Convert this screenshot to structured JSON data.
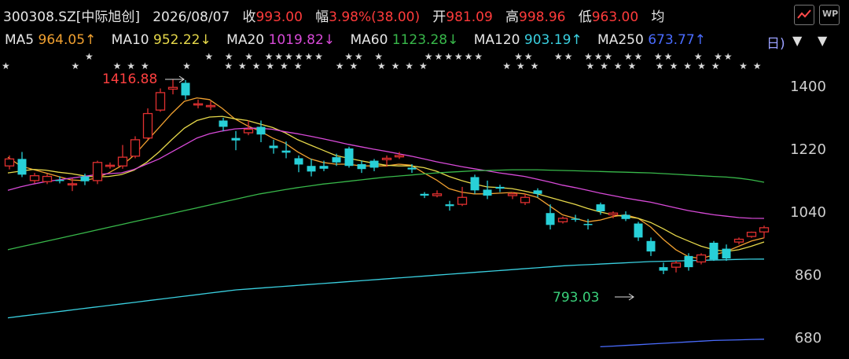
{
  "header": {
    "code": "300308.SZ[中际旭创]",
    "date": "2026/08/07",
    "close_label": "收",
    "close_value": "993.00",
    "change_label": "幅",
    "change_value": "3.98%(38.00)",
    "open_label": "开",
    "open_value": "981.09",
    "high_label": "高",
    "high_value": "998.96",
    "low_label": "低",
    "low_value": "963.00",
    "avg_label": "均",
    "right_icons": [
      "trend-icon",
      "wp-icon"
    ],
    "wp_text": "WP"
  },
  "ma_bar": {
    "items": [
      {
        "name": "MA5",
        "value": "964.05↑",
        "color": "#f0a030"
      },
      {
        "name": "MA10",
        "value": "952.22↓",
        "color": "#e6d84a"
      },
      {
        "name": "MA20",
        "value": "1019.82↓",
        "color": "#d84ad8"
      },
      {
        "name": "MA60",
        "value": "1123.28↓",
        "color": "#38b84a"
      },
      {
        "name": "MA120",
        "value": "903.19↑",
        "color": "#3ad0e0"
      },
      {
        "name": "MA250",
        "value": "673.77↑",
        "color": "#4a6cff"
      }
    ],
    "tail_text": "日)",
    "dropdown_arrow": "▼"
  },
  "chart_data": {
    "type": "candlestick",
    "y_ticks": [
      680,
      860,
      1040,
      1220,
      1400
    ],
    "ylim": [
      660,
      1480
    ],
    "high_annotation": "1416.88",
    "low_annotation": "793.03",
    "star_glyph": "★",
    "stars_row1": [
      0,
      5,
      8,
      9,
      10,
      13,
      16,
      17,
      18,
      19,
      20,
      21,
      24,
      25,
      27,
      28,
      29,
      30,
      36,
      37,
      38,
      42,
      43,
      44,
      45,
      47,
      48,
      49,
      50,
      51,
      53,
      54
    ],
    "stars_row2": [
      0,
      12,
      14,
      16,
      18,
      19,
      20,
      21,
      22,
      23,
      26,
      27,
      29,
      34,
      35,
      36,
      37,
      38,
      39,
      43,
      44,
      47,
      48,
      50,
      51,
      52,
      54,
      55,
      57,
      58,
      61,
      63,
      64
    ],
    "candles": [
      {
        "o": 1170,
        "c": 1190,
        "h": 1200,
        "l": 1160
      },
      {
        "o": 1190,
        "c": 1145,
        "h": 1210,
        "l": 1138
      },
      {
        "o": 1128,
        "c": 1142,
        "h": 1150,
        "l": 1120
      },
      {
        "o": 1125,
        "c": 1140,
        "h": 1147,
        "l": 1118
      },
      {
        "o": 1130,
        "c": 1128,
        "h": 1140,
        "l": 1120
      },
      {
        "o": 1118,
        "c": 1119,
        "h": 1135,
        "l": 1098
      },
      {
        "o": 1140,
        "c": 1126,
        "h": 1148,
        "l": 1115
      },
      {
        "o": 1128,
        "c": 1180,
        "h": 1185,
        "l": 1118
      },
      {
        "o": 1170,
        "c": 1172,
        "h": 1180,
        "l": 1162
      },
      {
        "o": 1170,
        "c": 1195,
        "h": 1230,
        "l": 1162
      },
      {
        "o": 1198,
        "c": 1245,
        "h": 1255,
        "l": 1192
      },
      {
        "o": 1250,
        "c": 1320,
        "h": 1335,
        "l": 1246
      },
      {
        "o": 1330,
        "c": 1380,
        "h": 1392,
        "l": 1325
      },
      {
        "o": 1390,
        "c": 1395,
        "h": 1416.88,
        "l": 1375
      },
      {
        "o": 1408,
        "c": 1372,
        "h": 1416,
        "l": 1360
      },
      {
        "o": 1345,
        "c": 1348,
        "h": 1360,
        "l": 1335
      },
      {
        "o": 1342,
        "c": 1343,
        "h": 1355,
        "l": 1330
      },
      {
        "o": 1300,
        "c": 1282,
        "h": 1308,
        "l": 1270
      },
      {
        "o": 1250,
        "c": 1243,
        "h": 1270,
        "l": 1215
      },
      {
        "o": 1265,
        "c": 1275,
        "h": 1300,
        "l": 1258
      },
      {
        "o": 1282,
        "c": 1260,
        "h": 1300,
        "l": 1238
      },
      {
        "o": 1228,
        "c": 1221,
        "h": 1245,
        "l": 1205
      },
      {
        "o": 1214,
        "c": 1208,
        "h": 1240,
        "l": 1192
      },
      {
        "o": 1192,
        "c": 1174,
        "h": 1200,
        "l": 1152
      },
      {
        "o": 1170,
        "c": 1154,
        "h": 1190,
        "l": 1140
      },
      {
        "o": 1170,
        "c": 1162,
        "h": 1185,
        "l": 1155
      },
      {
        "o": 1195,
        "c": 1180,
        "h": 1205,
        "l": 1170
      },
      {
        "o": 1220,
        "c": 1170,
        "h": 1225,
        "l": 1165
      },
      {
        "o": 1175,
        "c": 1161,
        "h": 1185,
        "l": 1150
      },
      {
        "o": 1185,
        "c": 1165,
        "h": 1190,
        "l": 1155
      },
      {
        "o": 1188,
        "c": 1192,
        "h": 1200,
        "l": 1168
      },
      {
        "o": 1196,
        "c": 1200,
        "h": 1210,
        "l": 1190
      },
      {
        "o": 1165,
        "c": 1160,
        "h": 1175,
        "l": 1150
      },
      {
        "o": 1090,
        "c": 1085,
        "h": 1095,
        "l": 1078
      },
      {
        "o": 1085,
        "c": 1090,
        "h": 1100,
        "l": 1080
      },
      {
        "o": 1060,
        "c": 1055,
        "h": 1070,
        "l": 1042
      },
      {
        "o": 1060,
        "c": 1080,
        "h": 1110,
        "l": 1055
      },
      {
        "o": 1138,
        "c": 1100,
        "h": 1145,
        "l": 1090
      },
      {
        "o": 1102,
        "c": 1085,
        "h": 1128,
        "l": 1075
      },
      {
        "o": 1110,
        "c": 1105,
        "h": 1116,
        "l": 1095
      },
      {
        "o": 1085,
        "c": 1090,
        "h": 1095,
        "l": 1075
      },
      {
        "o": 1065,
        "c": 1080,
        "h": 1090,
        "l": 1058
      },
      {
        "o": 1100,
        "c": 1090,
        "h": 1106,
        "l": 1080
      },
      {
        "o": 1035,
        "c": 1001,
        "h": 1060,
        "l": 988
      },
      {
        "o": 1010,
        "c": 1020,
        "h": 1025,
        "l": 1005
      },
      {
        "o": 1019,
        "c": 1018,
        "h": 1030,
        "l": 1010
      },
      {
        "o": 1004,
        "c": 1002,
        "h": 1018,
        "l": 988
      },
      {
        "o": 1060,
        "c": 1040,
        "h": 1065,
        "l": 1030
      },
      {
        "o": 1030,
        "c": 1035,
        "h": 1040,
        "l": 1020
      },
      {
        "o": 1030,
        "c": 1018,
        "h": 1040,
        "l": 1012
      },
      {
        "o": 1005,
        "c": 965,
        "h": 1010,
        "l": 955
      },
      {
        "o": 955,
        "c": 925,
        "h": 965,
        "l": 912
      },
      {
        "o": 880,
        "c": 870,
        "h": 893,
        "l": 860
      },
      {
        "o": 880,
        "c": 892,
        "h": 898,
        "l": 865
      },
      {
        "o": 912,
        "c": 880,
        "h": 920,
        "l": 870
      },
      {
        "o": 895,
        "c": 915,
        "h": 920,
        "l": 888
      },
      {
        "o": 950,
        "c": 902,
        "h": 955,
        "l": 898
      },
      {
        "o": 933,
        "c": 905,
        "h": 945,
        "l": 898
      },
      {
        "o": 952,
        "c": 960,
        "h": 965,
        "l": 945
      },
      {
        "o": 968,
        "c": 980,
        "h": 982,
        "l": 964
      },
      {
        "o": 981,
        "c": 993,
        "h": 998.96,
        "l": 963
      }
    ],
    "candle_colors": {
      "up": "#e03030",
      "down": "#28d0d8"
    },
    "ma_series": [
      {
        "name": "MA5",
        "color": "#f0a030",
        "values": [
          1195,
          1170,
          1160,
          1150,
          1140,
          1130,
          1128,
          1135,
          1150,
          1170,
          1200,
          1240,
          1280,
          1320,
          1355,
          1365,
          1360,
          1335,
          1305,
          1285,
          1270,
          1250,
          1235,
          1210,
          1190,
          1180,
          1175,
          1175,
          1170,
          1170,
          1170,
          1175,
          1172,
          1150,
          1130,
          1105,
          1095,
          1090,
          1090,
          1092,
          1094,
          1090,
          1080,
          1055,
          1030,
          1020,
          1010,
          1015,
          1025,
          1030,
          1020,
          995,
          960,
          930,
          910,
          905,
          915,
          925,
          940,
          955,
          964.05
        ]
      },
      {
        "name": "MA10",
        "color": "#e6d84a",
        "values": [
          1150,
          1155,
          1160,
          1158,
          1152,
          1148,
          1142,
          1138,
          1140,
          1145,
          1158,
          1180,
          1210,
          1245,
          1278,
          1300,
          1310,
          1312,
          1305,
          1300,
          1290,
          1280,
          1265,
          1245,
          1230,
          1215,
          1200,
          1192,
          1185,
          1178,
          1172,
          1170,
          1170,
          1165,
          1155,
          1140,
          1128,
          1118,
          1110,
          1108,
          1105,
          1098,
          1090,
          1080,
          1070,
          1060,
          1048,
          1038,
          1030,
          1025,
          1020,
          1008,
          990,
          970,
          955,
          940,
          930,
          925,
          930,
          940,
          952.22
        ]
      },
      {
        "name": "MA20",
        "color": "#d84ad8",
        "values": [
          1100,
          1110,
          1118,
          1125,
          1130,
          1135,
          1140,
          1145,
          1148,
          1150,
          1160,
          1175,
          1190,
          1210,
          1230,
          1250,
          1262,
          1270,
          1276,
          1278,
          1278,
          1275,
          1268,
          1262,
          1255,
          1248,
          1240,
          1232,
          1225,
          1218,
          1212,
          1205,
          1198,
          1190,
          1182,
          1175,
          1168,
          1162,
          1156,
          1150,
          1145,
          1140,
          1132,
          1124,
          1115,
          1108,
          1100,
          1092,
          1085,
          1078,
          1072,
          1066,
          1058,
          1050,
          1042,
          1036,
          1030,
          1026,
          1022,
          1020,
          1019.82
        ]
      },
      {
        "name": "MA60",
        "color": "#38b84a",
        "values": [
          930,
          938,
          946,
          954,
          962,
          970,
          978,
          986,
          994,
          1002,
          1010,
          1018,
          1026,
          1034,
          1042,
          1050,
          1058,
          1066,
          1074,
          1082,
          1090,
          1096,
          1102,
          1108,
          1113,
          1118,
          1122,
          1126,
          1130,
          1134,
          1138,
          1141,
          1144,
          1147,
          1150,
          1152,
          1154,
          1156,
          1157,
          1158,
          1159,
          1159,
          1159,
          1158,
          1157,
          1156,
          1155,
          1154,
          1153,
          1152,
          1151,
          1150,
          1148,
          1146,
          1144,
          1142,
          1140,
          1138,
          1135,
          1130,
          1123.28
        ]
      },
      {
        "name": "MA120",
        "color": "#3ad0e0",
        "values": [
          735,
          740,
          745,
          750,
          755,
          760,
          765,
          770,
          775,
          780,
          785,
          790,
          795,
          800,
          805,
          810,
          815,
          818,
          821,
          824,
          827,
          830,
          833,
          836,
          839,
          842,
          845,
          848,
          851,
          854,
          857,
          860,
          863,
          866,
          869,
          872,
          875,
          878,
          881,
          884,
          886,
          888,
          890,
          892,
          894,
          896,
          897,
          898,
          899,
          900,
          901,
          902,
          903,
          903.19
        ]
      },
      {
        "name": "MA250",
        "color": "#4a6cff",
        "values": [
          null,
          null,
          null,
          null,
          null,
          null,
          null,
          null,
          null,
          null,
          null,
          null,
          null,
          null,
          null,
          null,
          null,
          null,
          null,
          null,
          null,
          null,
          null,
          null,
          null,
          null,
          null,
          null,
          null,
          null,
          null,
          null,
          null,
          null,
          null,
          null,
          null,
          null,
          null,
          null,
          null,
          null,
          null,
          null,
          null,
          null,
          null,
          652,
          654,
          656,
          658,
          660,
          662,
          664,
          666,
          668,
          670,
          671,
          672,
          673,
          673.77
        ]
      }
    ]
  }
}
